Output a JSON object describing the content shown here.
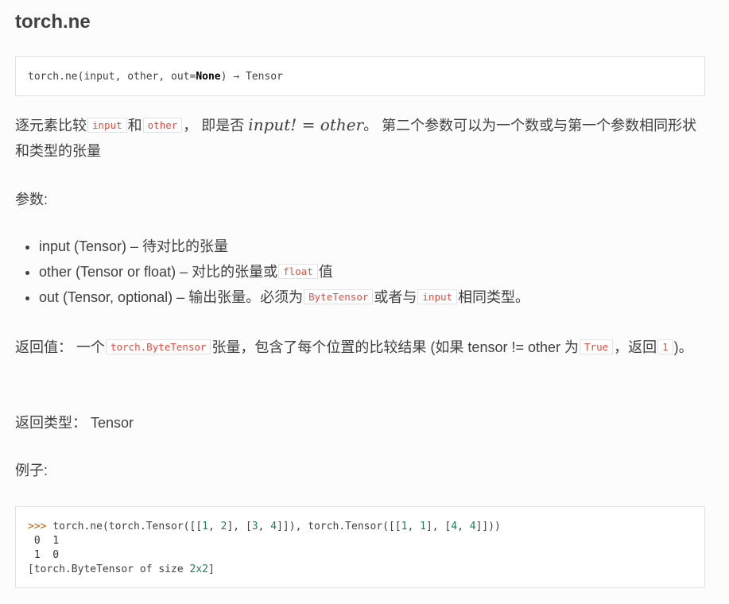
{
  "title": "torch.ne",
  "signature": {
    "prefix": "torch.ne(input, other, out=",
    "none": "None",
    "suffix": ") → Tensor"
  },
  "description": {
    "part1": "逐元素比较",
    "code_input": "input",
    "part2": "和",
    "code_other": "other",
    "part3": "， 即是否 ",
    "math": "input! = other",
    "part4": "。 第二个参数可以为一个数或与第一个参数相同形状和类型的张量"
  },
  "params_heading": "参数:",
  "params": [
    {
      "text": "input (Tensor) – 待对比的张量"
    },
    {
      "text": "other (Tensor or float) – 对比的张量或",
      "code": "float",
      "after": "值"
    },
    {
      "text": "out (Tensor, optional) – 输出张量。必须为",
      "code": "ByteTensor",
      "after": "或者与",
      "code2": "input",
      "after2": "相同类型。"
    }
  ],
  "returns": {
    "part1": "返回值： 一个",
    "code1": "torch.ByteTensor",
    "part2": "张量，包含了每个位置的比较结果 (如果 tensor != other 为",
    "code2": "True",
    "part3": "，返回",
    "code3": "1",
    "part4": ")。"
  },
  "return_type": "返回类型： Tensor",
  "example_heading": "例子:",
  "example": {
    "prompt": ">>>",
    "call_a": " torch.ne(torch.Tensor([[",
    "n1": "1",
    "c1": ", ",
    "n2": "2",
    "c2": "], [",
    "n3": "3",
    "c3": ", ",
    "n4": "4",
    "c4": "]]), torch.Tensor([[",
    "n5": "1",
    "c5": ", ",
    "n6": "1",
    "c6": "], [",
    "n7": "4",
    "c7": ", ",
    "n8": "4",
    "c8": "]]))",
    "row1": " 0  1",
    "row2": " 1  0",
    "footer_a": "[torch.ByteTensor of size ",
    "footer_n": "2x2",
    "footer_b": "]"
  },
  "colors": {
    "code_literal": "#e74c3c",
    "prompt": "#c65d09",
    "number": "#208050"
  }
}
